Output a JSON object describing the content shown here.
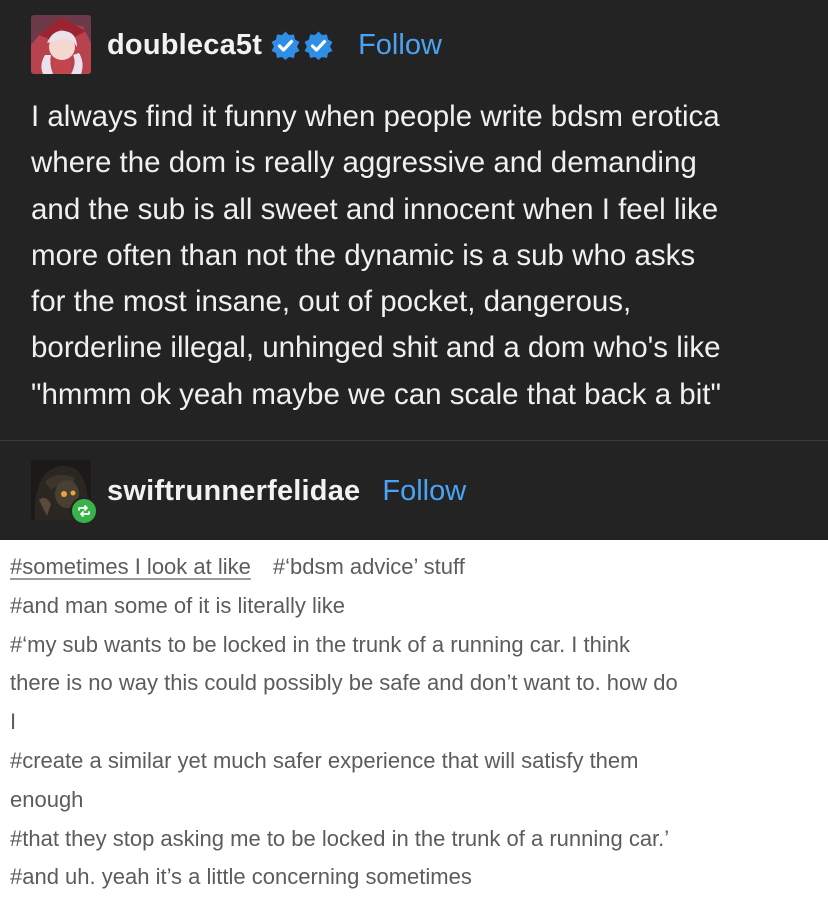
{
  "post": {
    "username": "doubleca5t",
    "follow_label": "Follow",
    "badges": [
      "verified-badge-icon",
      "verified-badge-icon"
    ],
    "text": "I always find it funny when people write bdsm erotica\nwhere the dom is really aggressive and demanding\nand the sub is all sweet and innocent when I feel like\nmore often than not the dynamic is a sub who asks\nfor the most insane, out of pocket, dangerous,\nborderline illegal, unhinged shit and a dom who's like\n\"hmmm ok yeah maybe we can scale that back a bit\""
  },
  "reblog": {
    "username": "swiftrunnerfelidae",
    "follow_label": "Follow",
    "tags": {
      "line1_a": "#sometimes I look at like",
      "line1_b": "#‘bdsm advice’ stuff",
      "line2": "#and man some of it is literally like",
      "line3": "#‘my sub wants to be locked in the trunk of a running car. I think",
      "line4": "there is no way this could possibly be safe and don’t want to. how do",
      "line5": "I",
      "line6": "#create a similar yet much safer experience that will satisfy them",
      "line7": "enough",
      "line8": "#that they stop asking me to be locked in the trunk of a running car.’",
      "line9": "#and uh. yeah it’s a little concerning sometimes"
    }
  },
  "colors": {
    "background_dark": "#232323",
    "link_blue": "#4aa3f5",
    "badge_blue": "#2f8ee6",
    "reblog_green": "#38b34a"
  }
}
